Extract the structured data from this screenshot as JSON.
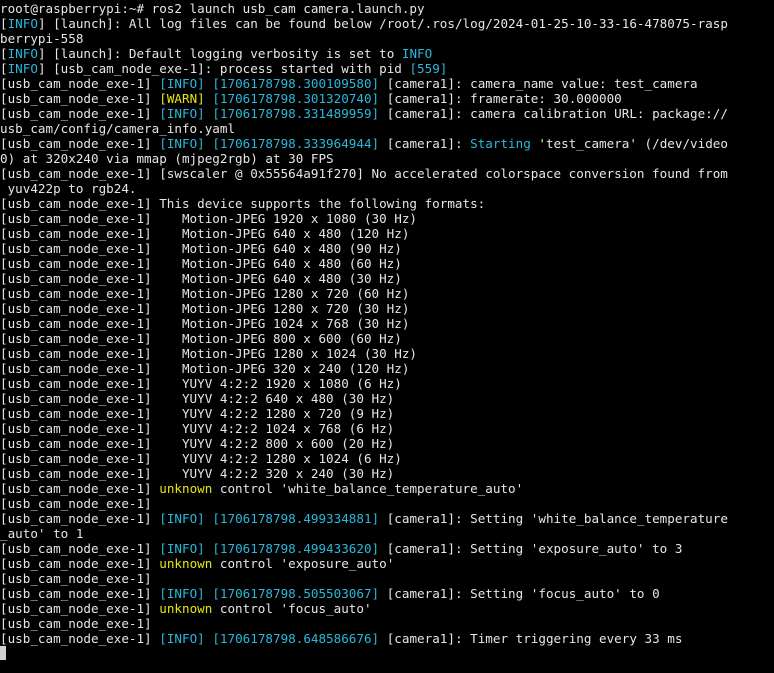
{
  "colors": {
    "default": "#e6e6e6",
    "cyan": "#29b8db",
    "yellow": "#e5e510",
    "blue": "#3b8eea"
  },
  "lines": [
    [
      {
        "t": "root@raspberrypi:~# ros2 launch usb_cam camera.launch.py"
      }
    ],
    [
      {
        "t": "["
      },
      {
        "t": "INFO",
        "c": "cyan"
      },
      {
        "t": "] [launch]: All log files can be found below /root/.ros/log/2024-01-25-10-33-16-478075-rasp"
      }
    ],
    [
      {
        "t": "berrypi-558"
      }
    ],
    [
      {
        "t": "["
      },
      {
        "t": "INFO",
        "c": "cyan"
      },
      {
        "t": "] [launch]: Default logging verbosity is set to "
      },
      {
        "t": "INFO",
        "c": "cyan"
      }
    ],
    [
      {
        "t": "["
      },
      {
        "t": "INFO",
        "c": "cyan"
      },
      {
        "t": "] [usb_cam_node_exe-1]: process started with pid "
      },
      {
        "t": "[559]",
        "c": "cyan"
      }
    ],
    [
      {
        "t": "[usb_cam_node_exe-1] "
      },
      {
        "t": "[INFO]",
        "c": "cyan"
      },
      {
        "t": " "
      },
      {
        "t": "[1706178798.300109580]",
        "c": "cyan"
      },
      {
        "t": " [camera1]: camera_name value: test_camera"
      }
    ],
    [
      {
        "t": "[usb_cam_node_exe-1] "
      },
      {
        "t": "[WARN]",
        "c": "yellow"
      },
      {
        "t": " "
      },
      {
        "t": "[1706178798.301320740]",
        "c": "cyan"
      },
      {
        "t": " [camera1]: framerate: 30.000000"
      }
    ],
    [
      {
        "t": "[usb_cam_node_exe-1] "
      },
      {
        "t": "[INFO]",
        "c": "cyan"
      },
      {
        "t": " "
      },
      {
        "t": "[1706178798.331489959]",
        "c": "cyan"
      },
      {
        "t": " [camera1]: camera calibration URL: package://"
      }
    ],
    [
      {
        "t": "usb_cam/config/camera_info.yaml"
      }
    ],
    [
      {
        "t": "[usb_cam_node_exe-1] "
      },
      {
        "t": "[INFO]",
        "c": "cyan"
      },
      {
        "t": " "
      },
      {
        "t": "[1706178798.333964944]",
        "c": "cyan"
      },
      {
        "t": " [camera1]: "
      },
      {
        "t": "Starting",
        "c": "cyan"
      },
      {
        "t": " 'test_camera' (/dev/video"
      }
    ],
    [
      {
        "t": "0) at 320x240 via mmap (mjpeg2rgb) at 30 FPS"
      }
    ],
    [
      {
        "t": "[usb_cam_node_exe-1] [swscaler @ 0x55564a91f270] No accelerated colorspace conversion found from"
      }
    ],
    [
      {
        "t": " yuv422p to rgb24."
      }
    ],
    [
      {
        "t": "[usb_cam_node_exe-1] This device supports the following formats:"
      }
    ],
    [
      {
        "t": "[usb_cam_node_exe-1]    Motion-JPEG 1920 x 1080 (30 Hz)"
      }
    ],
    [
      {
        "t": "[usb_cam_node_exe-1]    Motion-JPEG 640 x 480 (120 Hz)"
      }
    ],
    [
      {
        "t": "[usb_cam_node_exe-1]    Motion-JPEG 640 x 480 (90 Hz)"
      }
    ],
    [
      {
        "t": "[usb_cam_node_exe-1]    Motion-JPEG 640 x 480 (60 Hz)"
      }
    ],
    [
      {
        "t": "[usb_cam_node_exe-1]    Motion-JPEG 640 x 480 (30 Hz)"
      }
    ],
    [
      {
        "t": "[usb_cam_node_exe-1]    Motion-JPEG 1280 x 720 (60 Hz)"
      }
    ],
    [
      {
        "t": "[usb_cam_node_exe-1]    Motion-JPEG 1280 x 720 (30 Hz)"
      }
    ],
    [
      {
        "t": "[usb_cam_node_exe-1]    Motion-JPEG 1024 x 768 (30 Hz)"
      }
    ],
    [
      {
        "t": "[usb_cam_node_exe-1]    Motion-JPEG 800 x 600 (60 Hz)"
      }
    ],
    [
      {
        "t": "[usb_cam_node_exe-1]    Motion-JPEG 1280 x 1024 (30 Hz)"
      }
    ],
    [
      {
        "t": "[usb_cam_node_exe-1]    Motion-JPEG 320 x 240 (120 Hz)"
      }
    ],
    [
      {
        "t": "[usb_cam_node_exe-1]    YUYV 4:2:2 1920 x 1080 (6 Hz)"
      }
    ],
    [
      {
        "t": "[usb_cam_node_exe-1]    YUYV 4:2:2 640 x 480 (30 Hz)"
      }
    ],
    [
      {
        "t": "[usb_cam_node_exe-1]    YUYV 4:2:2 1280 x 720 (9 Hz)"
      }
    ],
    [
      {
        "t": "[usb_cam_node_exe-1]    YUYV 4:2:2 1024 x 768 (6 Hz)"
      }
    ],
    [
      {
        "t": "[usb_cam_node_exe-1]    YUYV 4:2:2 800 x 600 (20 Hz)"
      }
    ],
    [
      {
        "t": "[usb_cam_node_exe-1]    YUYV 4:2:2 1280 x 1024 (6 Hz)"
      }
    ],
    [
      {
        "t": "[usb_cam_node_exe-1]    YUYV 4:2:2 320 x 240 (30 Hz)"
      }
    ],
    [
      {
        "t": "[usb_cam_node_exe-1] "
      },
      {
        "t": "unknown",
        "c": "yellow"
      },
      {
        "t": " control 'white_balance_temperature_auto'"
      }
    ],
    [
      {
        "t": "[usb_cam_node_exe-1]"
      }
    ],
    [
      {
        "t": "[usb_cam_node_exe-1] "
      },
      {
        "t": "[INFO]",
        "c": "cyan"
      },
      {
        "t": " "
      },
      {
        "t": "[1706178798.499334881]",
        "c": "cyan"
      },
      {
        "t": " [camera1]: Setting 'white_balance_temperature"
      }
    ],
    [
      {
        "t": "_auto' to 1"
      }
    ],
    [
      {
        "t": "[usb_cam_node_exe-1] "
      },
      {
        "t": "[INFO]",
        "c": "cyan"
      },
      {
        "t": " "
      },
      {
        "t": "[1706178798.499433620]",
        "c": "cyan"
      },
      {
        "t": " [camera1]: Setting 'exposure_auto' to 3"
      }
    ],
    [
      {
        "t": "[usb_cam_node_exe-1] "
      },
      {
        "t": "unknown",
        "c": "yellow"
      },
      {
        "t": " control 'exposure_auto'"
      }
    ],
    [
      {
        "t": "[usb_cam_node_exe-1]"
      }
    ],
    [
      {
        "t": "[usb_cam_node_exe-1] "
      },
      {
        "t": "[INFO]",
        "c": "cyan"
      },
      {
        "t": " "
      },
      {
        "t": "[1706178798.505503067]",
        "c": "cyan"
      },
      {
        "t": " [camera1]: Setting 'focus_auto' to 0"
      }
    ],
    [
      {
        "t": "[usb_cam_node_exe-1] "
      },
      {
        "t": "unknown",
        "c": "yellow"
      },
      {
        "t": " control 'focus_auto'"
      }
    ],
    [
      {
        "t": "[usb_cam_node_exe-1]"
      }
    ],
    [
      {
        "t": "[usb_cam_node_exe-1] "
      },
      {
        "t": "[INFO]",
        "c": "cyan"
      },
      {
        "t": " "
      },
      {
        "t": "[1706178798.648586676]",
        "c": "cyan"
      },
      {
        "t": " [camera1]: Timer triggering every 33 ms"
      }
    ]
  ]
}
